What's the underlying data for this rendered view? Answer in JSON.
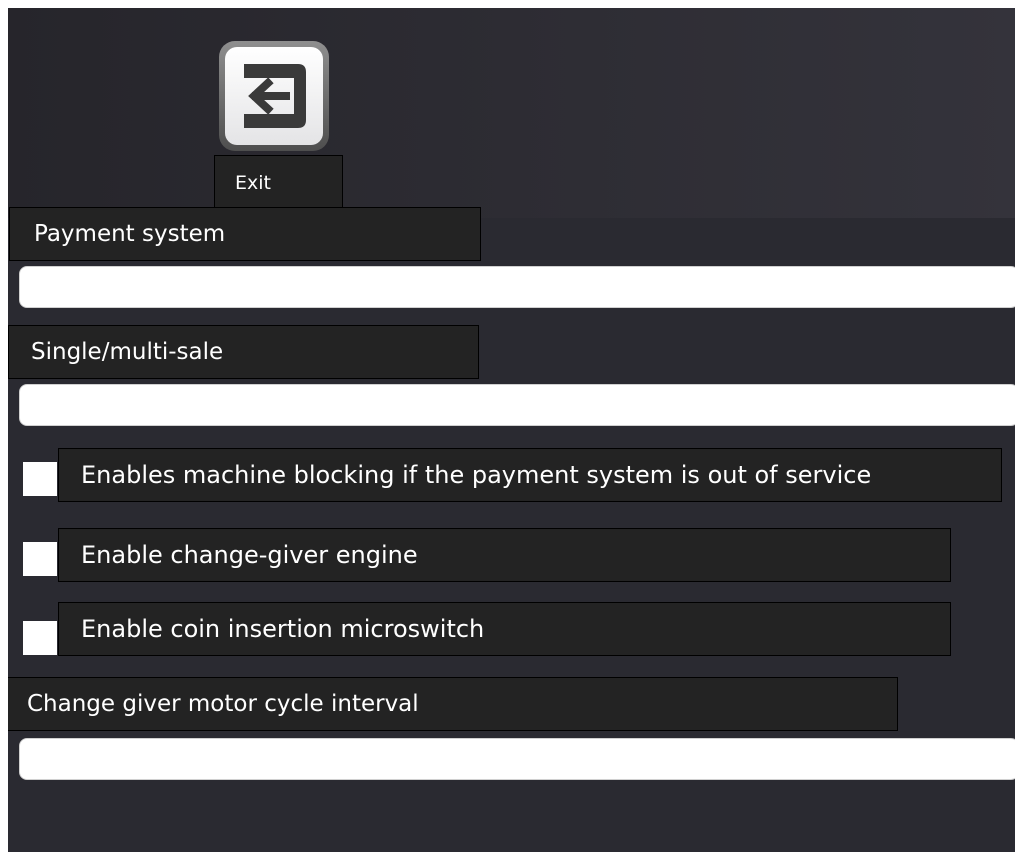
{
  "header": {
    "exit_icon": "exit-arrow-icon",
    "exit_label": "Exit"
  },
  "settings": {
    "payment_system": {
      "label": "Payment system",
      "value": ""
    },
    "single_multi_sale": {
      "label": "Single/multi-sale",
      "value": ""
    },
    "checkboxes": [
      {
        "label": "Enables machine blocking if the payment system is out of service",
        "checked": false
      },
      {
        "label": "Enable change-giver engine",
        "checked": false
      },
      {
        "label": "Enable coin insertion microswitch",
        "checked": false
      }
    ],
    "motor_cycle_interval": {
      "label": "Change giver motor cycle interval",
      "value": ""
    }
  },
  "colors": {
    "background": "#2a2a31",
    "label_box": "#232323",
    "field": "#ffffff"
  }
}
